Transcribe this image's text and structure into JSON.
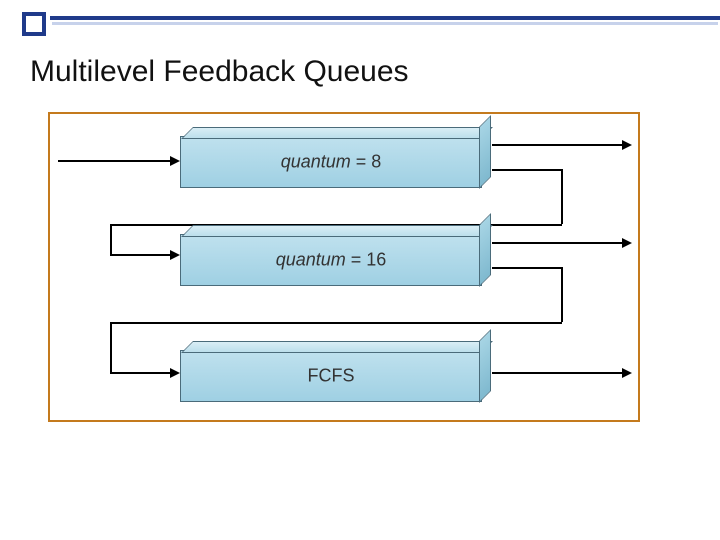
{
  "title": "Multilevel Feedback Queues",
  "queues": [
    {
      "label_prefix": "quantum",
      "label_value": "= 8",
      "use_italic": true
    },
    {
      "label_prefix": "quantum",
      "label_value": "= 16",
      "use_italic": true
    },
    {
      "label_prefix": "FCFS",
      "label_value": "",
      "use_italic": false
    }
  ]
}
